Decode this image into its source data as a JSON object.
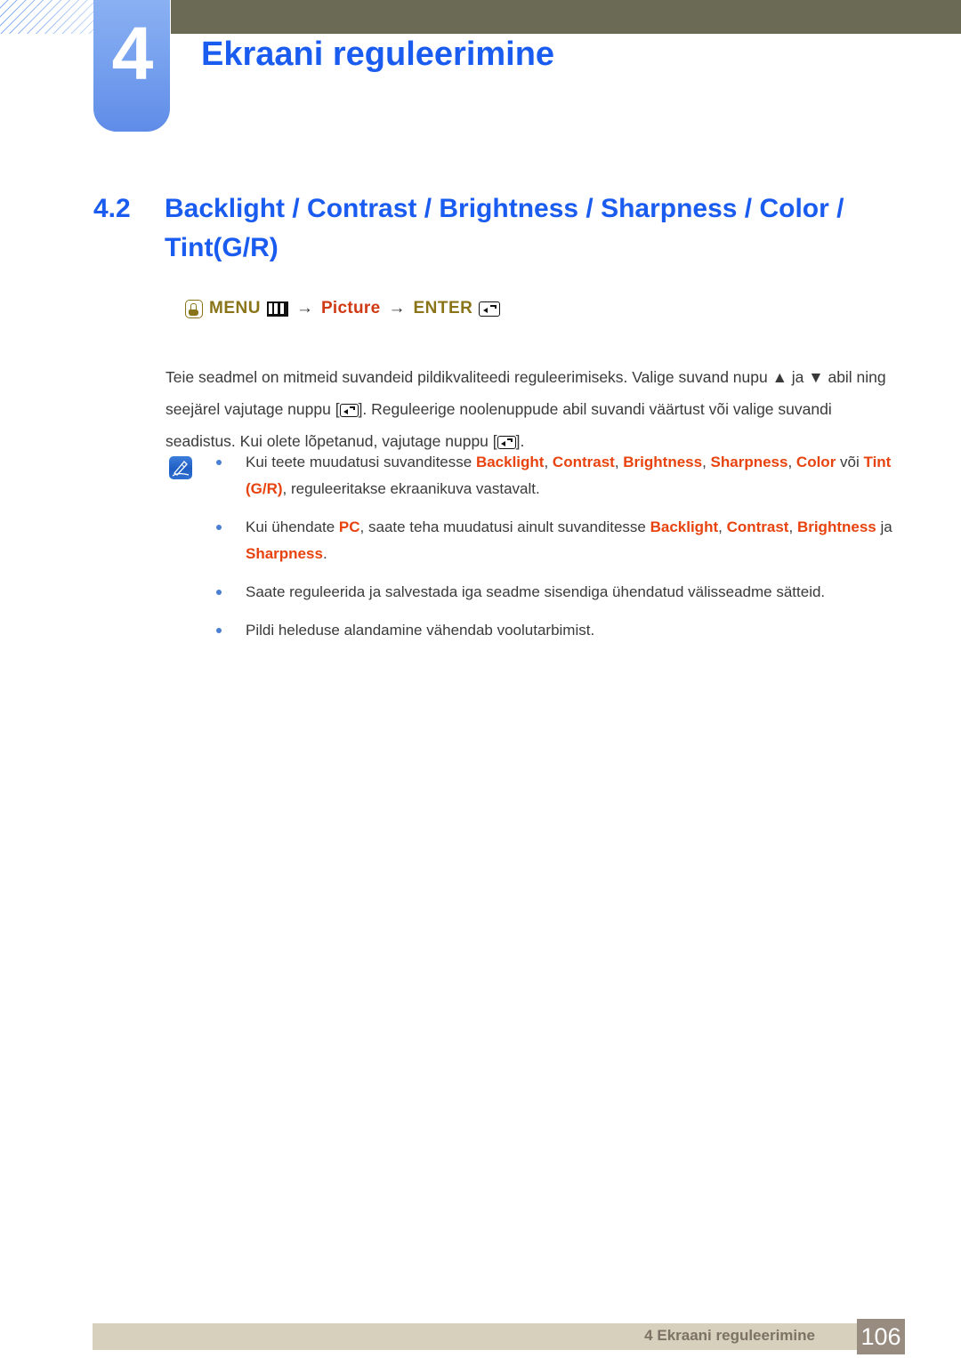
{
  "chapter": {
    "number": "4",
    "title": "Ekraani reguleerimine",
    "accent_color": "#1a5cf0",
    "badge_color": "#79a3ef",
    "bar_color": "#6b6a55"
  },
  "section": {
    "number": "4.2",
    "title": "Backlight / Contrast / Brightness / Sharpness / Color / Tint(G/R)"
  },
  "menu_path": {
    "hand_icon": "hand-pointer-icon",
    "menu_label": "MENU",
    "menu_icon": "menu-bars-icon",
    "arrow1": "→",
    "picture_label": "Picture",
    "arrow2": "→",
    "enter_label": "ENTER",
    "enter_icon": "enter-key-icon",
    "olive_color": "#8a7419",
    "red_color": "#cf3a14"
  },
  "intro": {
    "part1": "Teie seadmel on mitmeid suvandeid pildikvaliteedi reguleerimiseks. Valige suvand nupu ",
    "up_arrow": "▲",
    "part2": " ja ",
    "down_arrow": "▼",
    "part3": " abil ning seejärel vajutage nuppu [",
    "part4": "]. Reguleerige noolenuppude abil suvandi väärtust või valige suvandi seadistus. Kui olete lõpetanud, vajutage nuppu [",
    "part5": "]."
  },
  "note": {
    "icon": "note-pencil-icon",
    "highlight_color": "#e8430f",
    "bullet_color": "#4a7fd4",
    "items": [
      {
        "segments": [
          {
            "text": "Kui teete muudatusi suvanditesse ",
            "highlight": false
          },
          {
            "text": "Backlight",
            "highlight": true
          },
          {
            "text": ", ",
            "highlight": false
          },
          {
            "text": "Contrast",
            "highlight": true
          },
          {
            "text": ", ",
            "highlight": false
          },
          {
            "text": "Brightness",
            "highlight": true
          },
          {
            "text": ", ",
            "highlight": false
          },
          {
            "text": "Sharpness",
            "highlight": true
          },
          {
            "text": ", ",
            "highlight": false
          },
          {
            "text": "Color",
            "highlight": true
          },
          {
            "text": " või ",
            "highlight": false
          },
          {
            "text": "Tint (G/R)",
            "highlight": true
          },
          {
            "text": ", reguleeritakse ekraanikuva vastavalt.",
            "highlight": false
          }
        ]
      },
      {
        "segments": [
          {
            "text": "Kui ühendate ",
            "highlight": false
          },
          {
            "text": "PC",
            "highlight": true
          },
          {
            "text": ", saate teha muudatusi ainult suvanditesse ",
            "highlight": false
          },
          {
            "text": "Backlight",
            "highlight": true
          },
          {
            "text": ", ",
            "highlight": false
          },
          {
            "text": "Contrast",
            "highlight": true
          },
          {
            "text": ", ",
            "highlight": false
          },
          {
            "text": "Brightness",
            "highlight": true
          },
          {
            "text": " ja ",
            "highlight": false
          },
          {
            "text": "Sharpness",
            "highlight": true
          },
          {
            "text": ".",
            "highlight": false
          }
        ]
      },
      {
        "segments": [
          {
            "text": "Saate reguleerida ja salvestada iga seadme sisendiga ühendatud välisseadme sätteid.",
            "highlight": false
          }
        ]
      },
      {
        "segments": [
          {
            "text": "Pildi heleduse alandamine vähendab voolutarbimist.",
            "highlight": false
          }
        ]
      }
    ]
  },
  "footer": {
    "text": "4 Ekraani reguleerimine",
    "page_number": "106",
    "bar_color": "#d6d0bd",
    "page_box_color": "#988c80"
  }
}
